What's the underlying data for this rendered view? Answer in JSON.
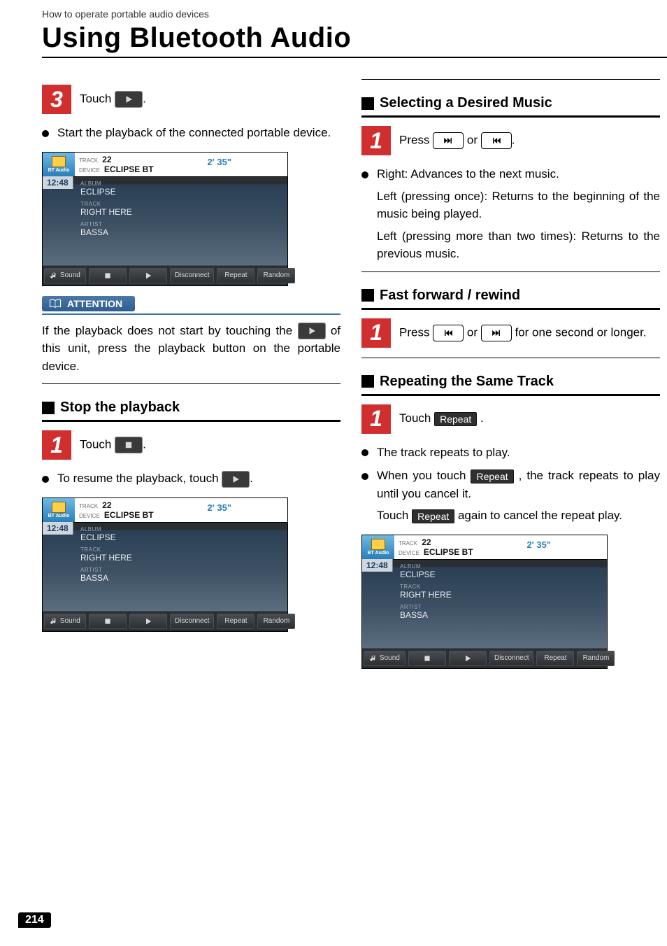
{
  "header": {
    "running": "How to operate portable audio devices",
    "title": "Using Bluetooth Audio"
  },
  "left": {
    "step3_num": "3",
    "step3_prefix": "Touch ",
    "step3_suffix": ".",
    "play_note": "Start the playback of the connected portable device.",
    "attention_label": "ATTENTION",
    "attention_body_a": "If the playback does not start by touching the ",
    "attention_body_b": " of this unit, press the playback button on the portable device.",
    "h_stop": "Stop the playback",
    "stop_step_num": "1",
    "stop_step_prefix": "Touch ",
    "stop_step_suffix": ".",
    "resume_prefix": "To resume the playback, touch ",
    "resume_suffix": "."
  },
  "right": {
    "h_select": "Selecting a Desired Music",
    "select_step_num": "1",
    "select_step_prefix": "Press ",
    "select_step_or": " or ",
    "select_step_suffix": ".",
    "select_bullet_a": "Right: Advances to the next music.",
    "select_sub_b": "Left (pressing once): Returns to the beginning of the music being played.",
    "select_sub_c": "Left (pressing more than two times): Returns to the previous music.",
    "h_ff": "Fast forward / rewind",
    "ff_step_num": "1",
    "ff_step_prefix": "Press ",
    "ff_step_or": " or ",
    "ff_step_suffix": " for one second or longer.",
    "h_repeat": "Repeating the Same Track",
    "repeat_step_num": "1",
    "repeat_step_prefix": "Touch ",
    "repeat_label": "Repeat",
    "repeat_step_suffix": " .",
    "repeat_bullet_a": "The track repeats to play.",
    "repeat_b_prefix": "When you touch ",
    "repeat_b_label": "Repeat",
    "repeat_b_mid": " , the track repeats to play until you cancel it.",
    "repeat_c_prefix": "Touch ",
    "repeat_c_label": "Repeat",
    "repeat_c_suffix": " again to cancel the repeat play."
  },
  "screen": {
    "source_label": "BT Audio",
    "track_lbl": "TRACK",
    "track_val": "22",
    "device_lbl": "DEVICE",
    "device_val": "ECLIPSE BT",
    "elapsed": "2' 35\"",
    "clock": "12:48",
    "album_lbl": "ALBUM",
    "album_val": "ECLIPSE",
    "trackname_lbl": "TRACK",
    "trackname_val": "RIGHT HERE",
    "artist_lbl": "ARTIST",
    "artist_val": "BASSA",
    "btn_sound": "Sound",
    "btn_disc": "Disconnect",
    "btn_repeat": "Repeat",
    "btn_random": "Random"
  },
  "page_number": "214",
  "icons": {
    "play": "play-icon",
    "stop": "stop-icon",
    "ff": "next-track-icon",
    "rw": "prev-track-icon",
    "book": "book-icon",
    "note": "music-note-icon"
  }
}
